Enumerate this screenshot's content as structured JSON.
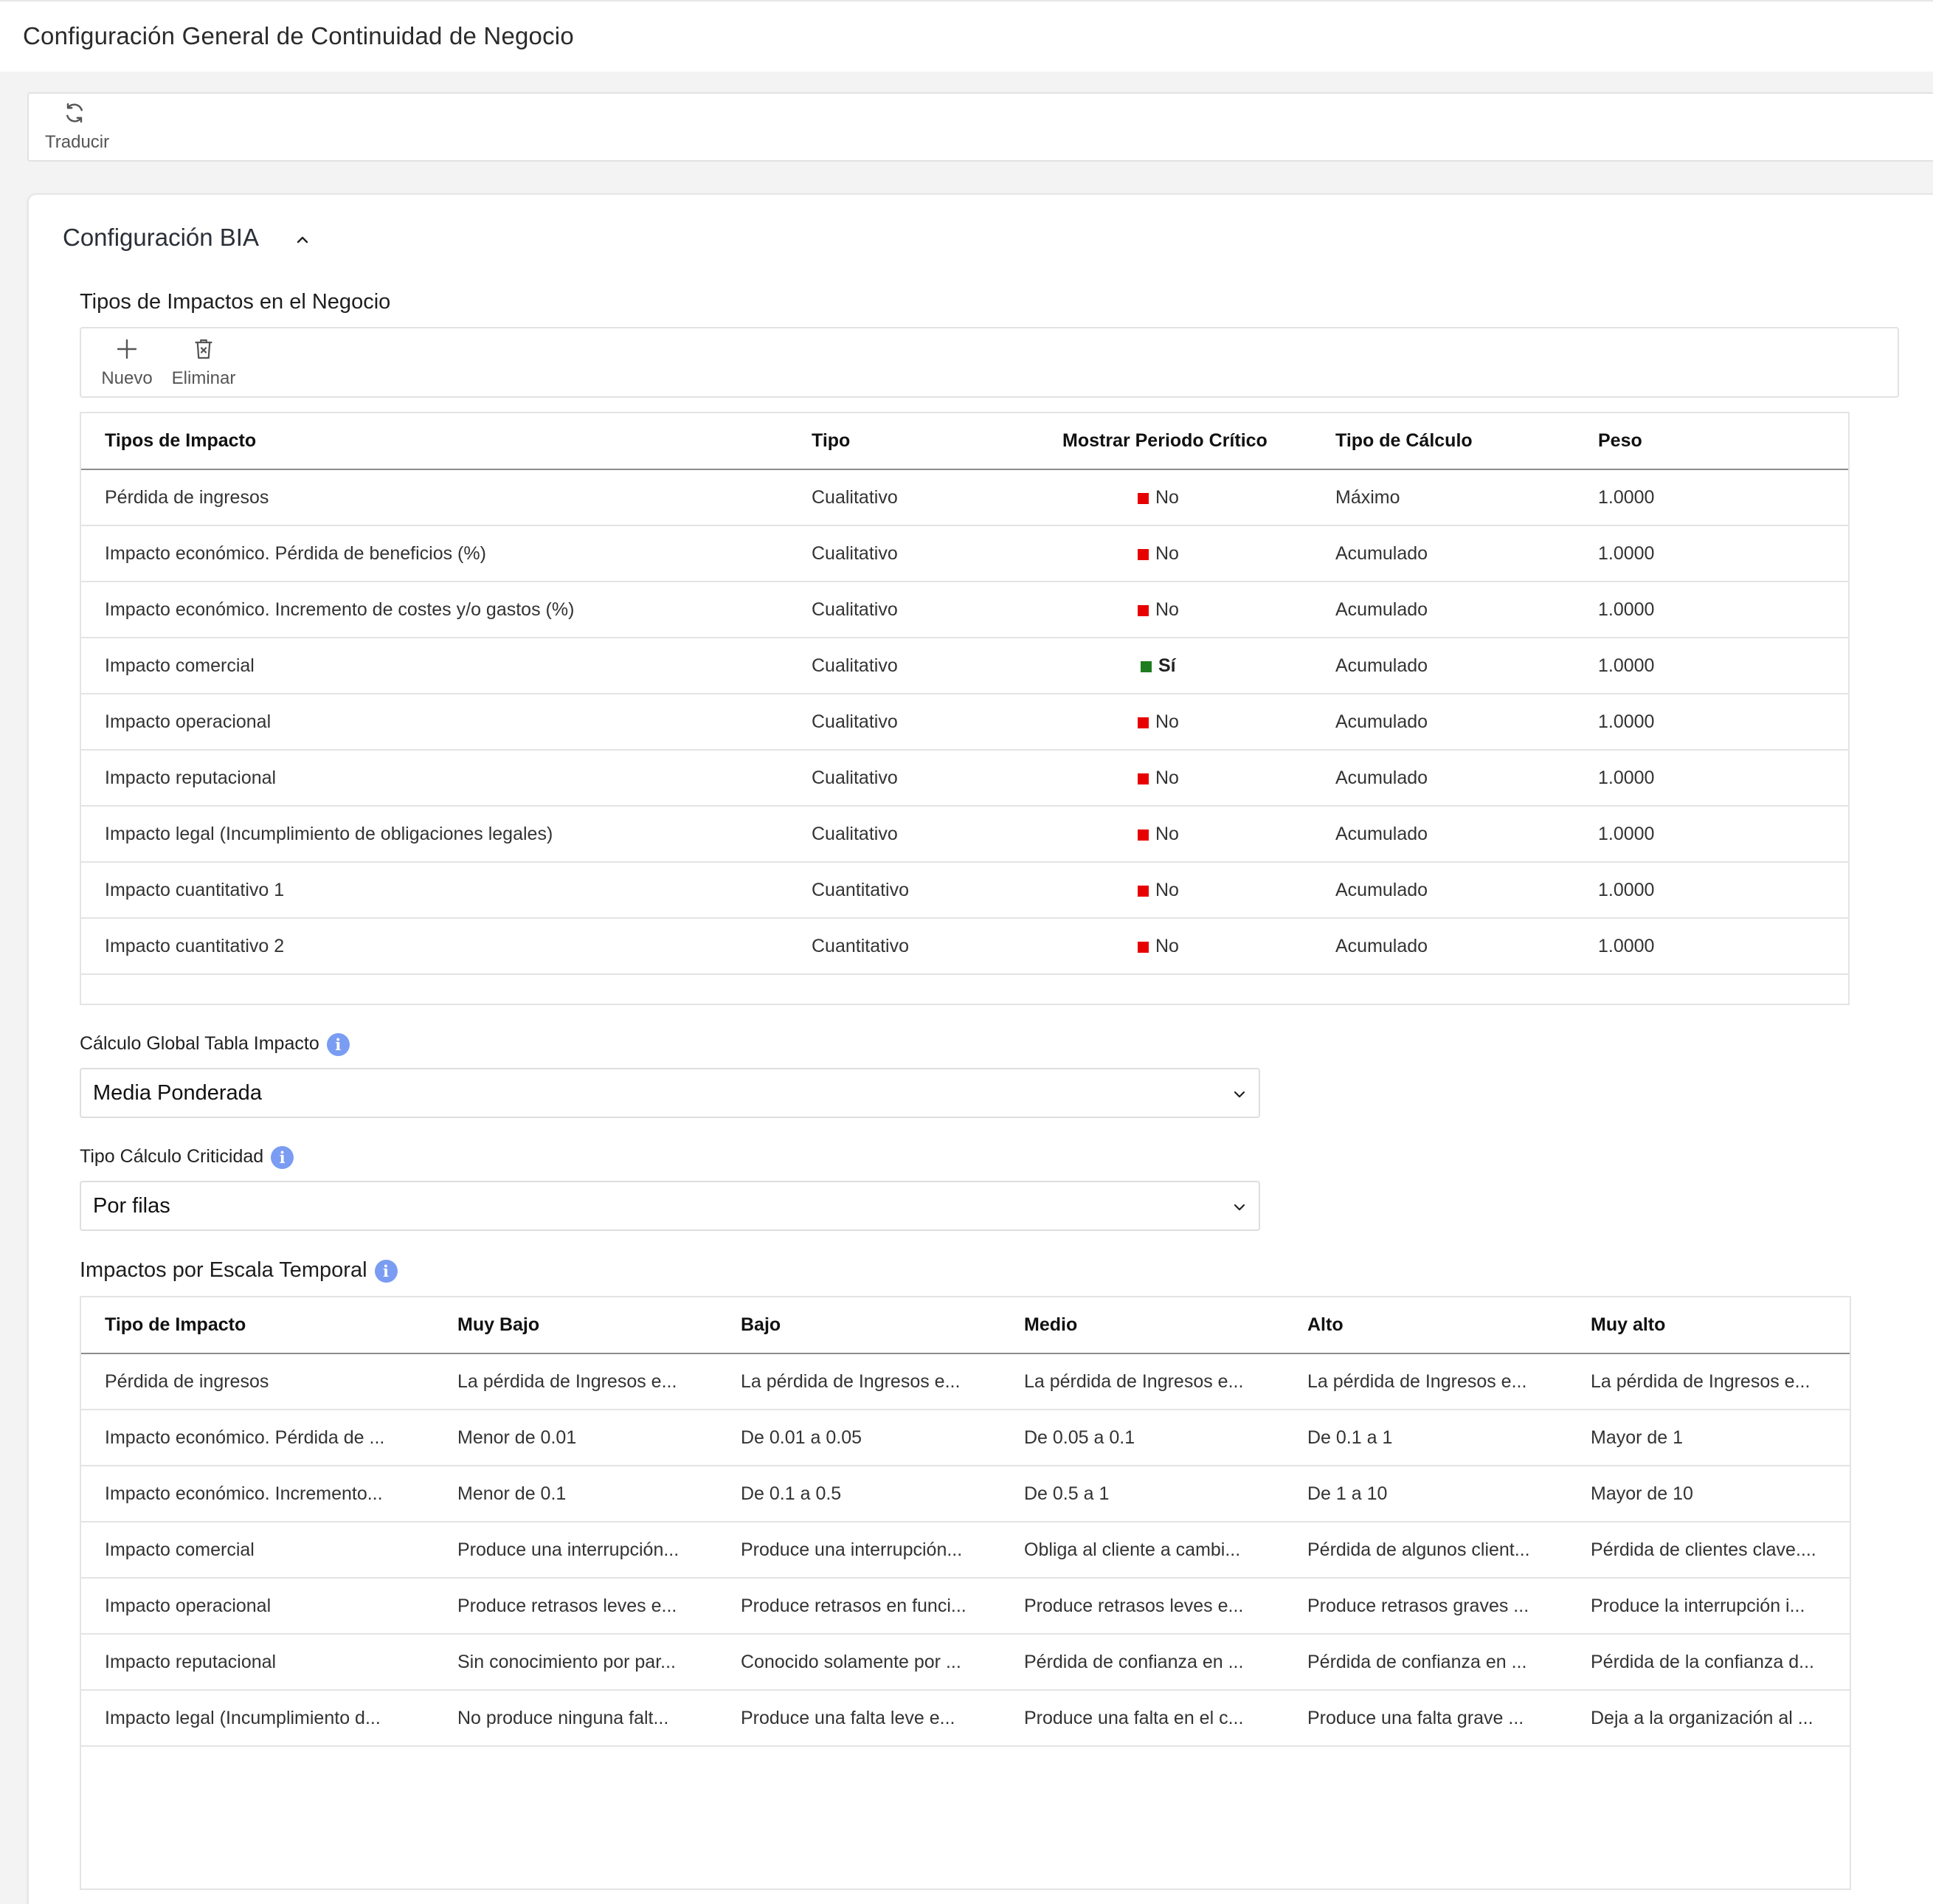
{
  "header": {
    "title": "Configuración General de Continuidad de Negocio"
  },
  "toolbar": {
    "translate_label": "Traducir"
  },
  "section": {
    "title": "Configuración BIA"
  },
  "impact_types": {
    "title": "Tipos de Impactos en el Negocio",
    "new_label": "Nuevo",
    "delete_label": "Eliminar",
    "columns": [
      "Tipos de Impacto",
      "Tipo",
      "Mostrar Periodo Crítico",
      "Tipo de Cálculo",
      "Peso"
    ],
    "rows": [
      {
        "name": "Pérdida de ingresos",
        "type": "Cualitativo",
        "critical": "No",
        "calc": "Máximo",
        "weight": "1.0000"
      },
      {
        "name": "Impacto económico. Pérdida de beneficios (%)",
        "type": "Cualitativo",
        "critical": "No",
        "calc": "Acumulado",
        "weight": "1.0000"
      },
      {
        "name": "Impacto económico. Incremento de costes y/o gastos (%)",
        "type": "Cualitativo",
        "critical": "No",
        "calc": "Acumulado",
        "weight": "1.0000"
      },
      {
        "name": "Impacto comercial",
        "type": "Cualitativo",
        "critical": "Sí",
        "calc": "Acumulado",
        "weight": "1.0000"
      },
      {
        "name": "Impacto operacional",
        "type": "Cualitativo",
        "critical": "No",
        "calc": "Acumulado",
        "weight": "1.0000"
      },
      {
        "name": "Impacto reputacional",
        "type": "Cualitativo",
        "critical": "No",
        "calc": "Acumulado",
        "weight": "1.0000"
      },
      {
        "name": "Impacto legal (Incumplimiento de obligaciones legales)",
        "type": "Cualitativo",
        "critical": "No",
        "calc": "Acumulado",
        "weight": "1.0000"
      },
      {
        "name": "Impacto cuantitativo 1",
        "type": "Cuantitativo",
        "critical": "No",
        "calc": "Acumulado",
        "weight": "1.0000"
      },
      {
        "name": "Impacto cuantitativo 2",
        "type": "Cuantitativo",
        "critical": "No",
        "calc": "Acumulado",
        "weight": "1.0000"
      }
    ]
  },
  "global_calc": {
    "label": "Cálculo Global Tabla Impacto",
    "value": "Media Ponderada"
  },
  "criticality_calc": {
    "label": "Tipo Cálculo Criticidad",
    "value": "Por filas"
  },
  "temporal_scale": {
    "title": "Impactos por Escala Temporal",
    "columns": [
      "Tipo de Impacto",
      "Muy Bajo",
      "Bajo",
      "Medio",
      "Alto",
      "Muy alto"
    ],
    "rows": [
      [
        "Pérdida de ingresos",
        "La pérdida de Ingresos e...",
        "La pérdida de Ingresos e...",
        "La pérdida de Ingresos e...",
        "La pérdida de Ingresos e...",
        "La pérdida de Ingresos e..."
      ],
      [
        "Impacto económico. Pérdida de ...",
        "Menor de 0.01",
        "De 0.01 a 0.05",
        "De 0.05 a 0.1",
        "De 0.1 a 1",
        "Mayor de 1"
      ],
      [
        "Impacto económico. Incremento...",
        "Menor de 0.1",
        "De 0.1 a 0.5",
        "De 0.5 a 1",
        "De 1 a 10",
        "Mayor de 10"
      ],
      [
        "Impacto comercial",
        "Produce una interrupción...",
        "Produce una interrupción...",
        "Obliga al cliente a cambi...",
        "Pérdida de algunos client...",
        "Pérdida de clientes clave...."
      ],
      [
        "Impacto operacional",
        "Produce retrasos leves e...",
        "Produce retrasos en funci...",
        "Produce retrasos leves e...",
        "Produce retrasos graves ...",
        "Produce la interrupción i..."
      ],
      [
        "Impacto reputacional",
        "Sin conocimiento por par...",
        "Conocido solamente por ...",
        "Pérdida de confianza en ...",
        "Pérdida de confianza en ...",
        "Pérdida de la confianza d..."
      ],
      [
        "Impacto legal (Incumplimiento d...",
        "No produce ninguna falt...",
        "Produce una falta leve e...",
        "Produce una falta en el c...",
        "Produce una falta grave ...",
        "Deja a la organización al ..."
      ]
    ]
  },
  "colors": {
    "flag_no": "#e60000",
    "flag_yes": "#1e7d1e",
    "info_icon": "#7a9cf2"
  }
}
